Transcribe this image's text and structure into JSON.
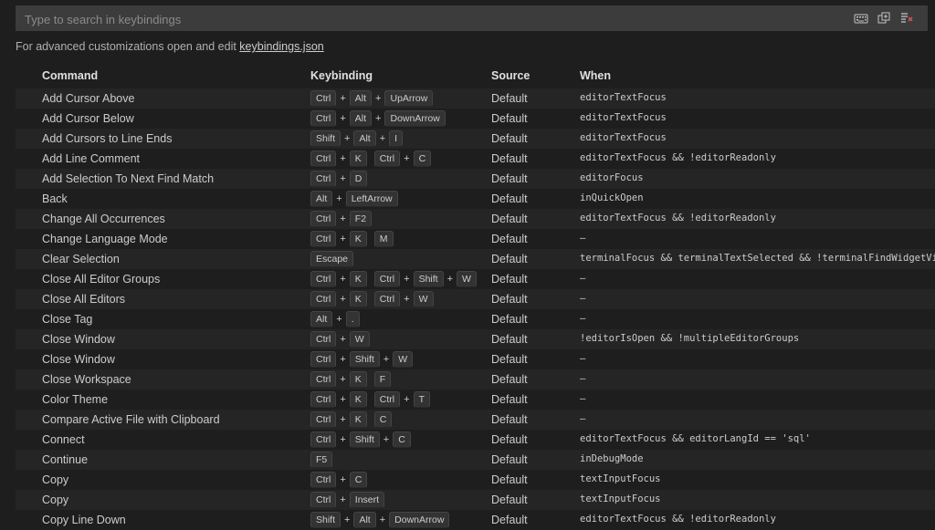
{
  "search": {
    "placeholder": "Type to search in keybindings"
  },
  "hint": {
    "prefix": "For advanced customizations open and edit ",
    "link": "keybindings.json"
  },
  "columns": {
    "command": "Command",
    "keybinding": "Keybinding",
    "source": "Source",
    "when": "When"
  },
  "rows": [
    {
      "command": "Add Cursor Above",
      "keys": [
        [
          "Ctrl",
          "Alt",
          "UpArrow"
        ]
      ],
      "source": "Default",
      "when": "editorTextFocus"
    },
    {
      "command": "Add Cursor Below",
      "keys": [
        [
          "Ctrl",
          "Alt",
          "DownArrow"
        ]
      ],
      "source": "Default",
      "when": "editorTextFocus"
    },
    {
      "command": "Add Cursors to Line Ends",
      "keys": [
        [
          "Shift",
          "Alt",
          "I"
        ]
      ],
      "source": "Default",
      "when": "editorTextFocus"
    },
    {
      "command": "Add Line Comment",
      "keys": [
        [
          "Ctrl",
          "K"
        ],
        [
          "Ctrl",
          "C"
        ]
      ],
      "source": "Default",
      "when": "editorTextFocus && !editorReadonly"
    },
    {
      "command": "Add Selection To Next Find Match",
      "keys": [
        [
          "Ctrl",
          "D"
        ]
      ],
      "source": "Default",
      "when": "editorFocus"
    },
    {
      "command": "Back",
      "keys": [
        [
          "Alt",
          "LeftArrow"
        ]
      ],
      "source": "Default",
      "when": "inQuickOpen"
    },
    {
      "command": "Change All Occurrences",
      "keys": [
        [
          "Ctrl",
          "F2"
        ]
      ],
      "source": "Default",
      "when": "editorTextFocus && !editorReadonly"
    },
    {
      "command": "Change Language Mode",
      "keys": [
        [
          "Ctrl",
          "K"
        ],
        [
          "M"
        ]
      ],
      "source": "Default",
      "when": "—"
    },
    {
      "command": "Clear Selection",
      "keys": [
        [
          "Escape"
        ]
      ],
      "source": "Default",
      "when": "terminalFocus && terminalTextSelected && !terminalFindWidgetVisi..."
    },
    {
      "command": "Close All Editor Groups",
      "keys": [
        [
          "Ctrl",
          "K"
        ],
        [
          "Ctrl",
          "Shift",
          "W"
        ]
      ],
      "source": "Default",
      "when": "—"
    },
    {
      "command": "Close All Editors",
      "keys": [
        [
          "Ctrl",
          "K"
        ],
        [
          "Ctrl",
          "W"
        ]
      ],
      "source": "Default",
      "when": "—"
    },
    {
      "command": "Close Tag",
      "keys": [
        [
          "Alt",
          "."
        ]
      ],
      "source": "Default",
      "when": "—"
    },
    {
      "command": "Close Window",
      "keys": [
        [
          "Ctrl",
          "W"
        ]
      ],
      "source": "Default",
      "when": "!editorIsOpen && !multipleEditorGroups"
    },
    {
      "command": "Close Window",
      "keys": [
        [
          "Ctrl",
          "Shift",
          "W"
        ]
      ],
      "source": "Default",
      "when": "—"
    },
    {
      "command": "Close Workspace",
      "keys": [
        [
          "Ctrl",
          "K"
        ],
        [
          "F"
        ]
      ],
      "source": "Default",
      "when": "—"
    },
    {
      "command": "Color Theme",
      "keys": [
        [
          "Ctrl",
          "K"
        ],
        [
          "Ctrl",
          "T"
        ]
      ],
      "source": "Default",
      "when": "—"
    },
    {
      "command": "Compare Active File with Clipboard",
      "keys": [
        [
          "Ctrl",
          "K"
        ],
        [
          "C"
        ]
      ],
      "source": "Default",
      "when": "—"
    },
    {
      "command": "Connect",
      "keys": [
        [
          "Ctrl",
          "Shift",
          "C"
        ]
      ],
      "source": "Default",
      "when": "editorTextFocus && editorLangId == 'sql'"
    },
    {
      "command": "Continue",
      "keys": [
        [
          "F5"
        ]
      ],
      "source": "Default",
      "when": "inDebugMode"
    },
    {
      "command": "Copy",
      "keys": [
        [
          "Ctrl",
          "C"
        ]
      ],
      "source": "Default",
      "when": "textInputFocus"
    },
    {
      "command": "Copy",
      "keys": [
        [
          "Ctrl",
          "Insert"
        ]
      ],
      "source": "Default",
      "when": "textInputFocus"
    },
    {
      "command": "Copy Line Down",
      "keys": [
        [
          "Shift",
          "Alt",
          "DownArrow"
        ]
      ],
      "source": "Default",
      "when": "editorTextFocus && !editorReadonly"
    }
  ]
}
